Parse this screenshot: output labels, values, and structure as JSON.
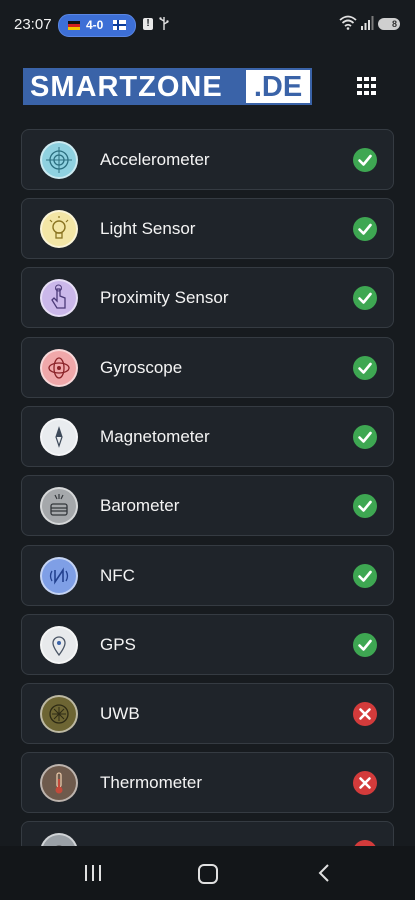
{
  "status_bar": {
    "time": "23:07",
    "score": "4-0",
    "alert_glyph": "!",
    "battery": "8"
  },
  "header": {
    "logo_main": "SMARTZONE",
    "logo_tld": ".DE"
  },
  "sensors": [
    {
      "label": "Accelerometer",
      "supported": true,
      "icon": "accelerometer-icon",
      "color": "#8fd1e0"
    },
    {
      "label": "Light Sensor",
      "supported": true,
      "icon": "light-bulb-icon",
      "color": "#f3e6a6"
    },
    {
      "label": "Proximity Sensor",
      "supported": true,
      "icon": "hand-tap-icon",
      "color": "#cbb8ea"
    },
    {
      "label": "Gyroscope",
      "supported": true,
      "icon": "gyroscope-icon",
      "color": "#f0a8aa"
    },
    {
      "label": "Magnetometer",
      "supported": true,
      "icon": "compass-icon",
      "color": "#e9ecef"
    },
    {
      "label": "Barometer",
      "supported": true,
      "icon": "barometer-icon",
      "color": "#a5a8ab"
    },
    {
      "label": "NFC",
      "supported": true,
      "icon": "nfc-icon",
      "color": "#7f9fe6"
    },
    {
      "label": "GPS",
      "supported": true,
      "icon": "gps-icon",
      "color": "#e8eaec"
    },
    {
      "label": "UWB",
      "supported": false,
      "icon": "uwb-icon",
      "color": "#6d6533"
    },
    {
      "label": "Thermometer",
      "supported": false,
      "icon": "thermometer-icon",
      "color": "#6e5a4c"
    },
    {
      "label": "",
      "supported": false,
      "icon": "sensor-icon",
      "color": "#9aa0a6"
    }
  ],
  "colors": {
    "background": "#171b1f",
    "card": "#1f242a",
    "supported": "#3ea752",
    "unsupported": "#d33b3b",
    "brand": "#3a63a8"
  }
}
